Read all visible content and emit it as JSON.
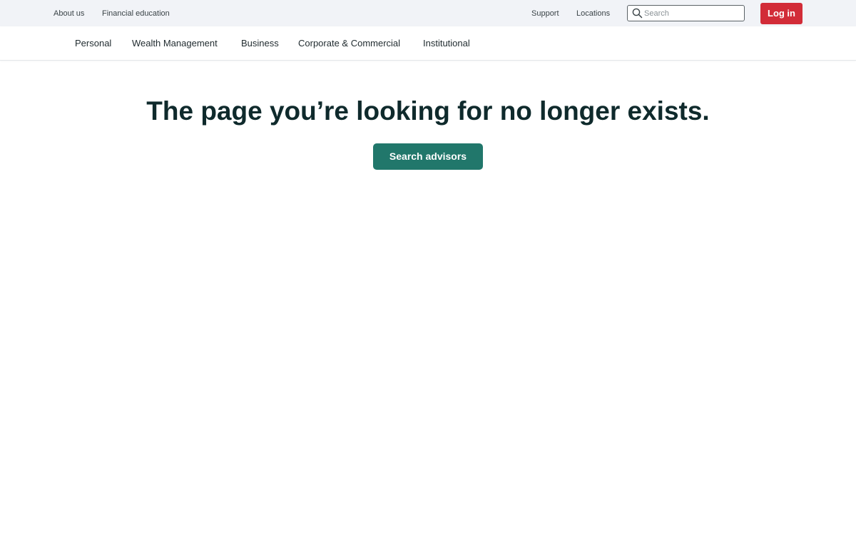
{
  "utility": {
    "links": {
      "about": "About us",
      "financial_education": "Financial education",
      "support": "Support",
      "locations": "Locations"
    },
    "search": {
      "placeholder": "Search",
      "value": "",
      "icon": "search-icon"
    },
    "login_label": "Log in"
  },
  "nav": {
    "items": [
      {
        "label": "Personal"
      },
      {
        "label": "Wealth Management"
      },
      {
        "label": "Business"
      },
      {
        "label": "Corporate & Commercial"
      },
      {
        "label": "Institutional"
      }
    ]
  },
  "main": {
    "title": "The page you’re looking for no longer exists.",
    "cta_label": "Search advisors"
  },
  "colors": {
    "utility_bg": "#f1f3f7",
    "login_red": "#d22c38",
    "cta_green": "#21776b",
    "title_text": "#0f2a2c"
  }
}
